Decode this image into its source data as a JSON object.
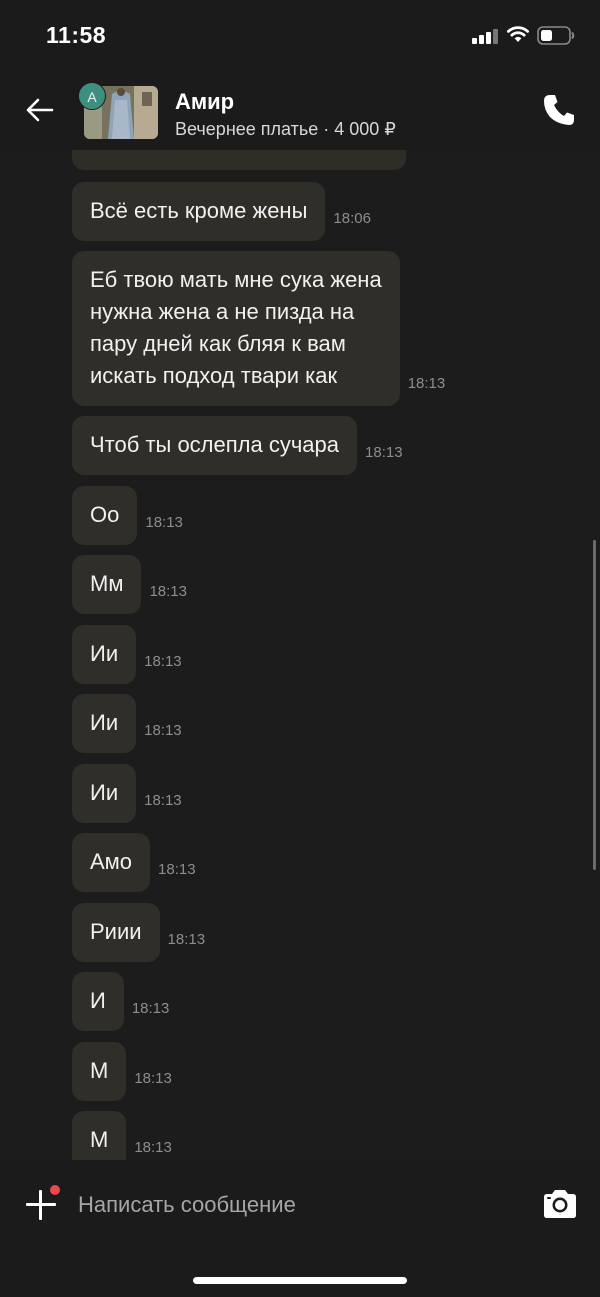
{
  "status_bar": {
    "time": "11:58"
  },
  "header": {
    "avatar_letter": "А",
    "name": "Амир",
    "item_line": "Вечернее платье · 4 000 ₽"
  },
  "messages": [
    {
      "text": "Всё есть кроме жены",
      "time": "18:06"
    },
    {
      "text": "Еб твою мать мне сука жена\nнужна жена а не пизда на\nпару дней как бляя к вам\nискать подход твари как",
      "time": "18:13"
    },
    {
      "text": "Чтоб ты ослепла сучара",
      "time": "18:13"
    },
    {
      "text": "Оо",
      "time": "18:13"
    },
    {
      "text": "Мм",
      "time": "18:13"
    },
    {
      "text": "Ии",
      "time": "18:13"
    },
    {
      "text": "Ии",
      "time": "18:13"
    },
    {
      "text": "Ии",
      "time": "18:13"
    },
    {
      "text": "Амо",
      "time": "18:13"
    },
    {
      "text": "Риии",
      "time": "18:13"
    },
    {
      "text": "И",
      "time": "18:13"
    },
    {
      "text": "М",
      "time": "18:13"
    },
    {
      "text": "М",
      "time": "18:13"
    }
  ],
  "composer": {
    "placeholder": "Написать сообщение"
  },
  "icons": {
    "back": "arrow-left-icon",
    "phone": "phone-icon",
    "add": "plus-icon",
    "camera": "camera-icon"
  },
  "colors": {
    "background": "#1b1b1b",
    "bubble": "#302e29",
    "avatar": "#3e8f80",
    "notification_dot": "#f0454b"
  }
}
